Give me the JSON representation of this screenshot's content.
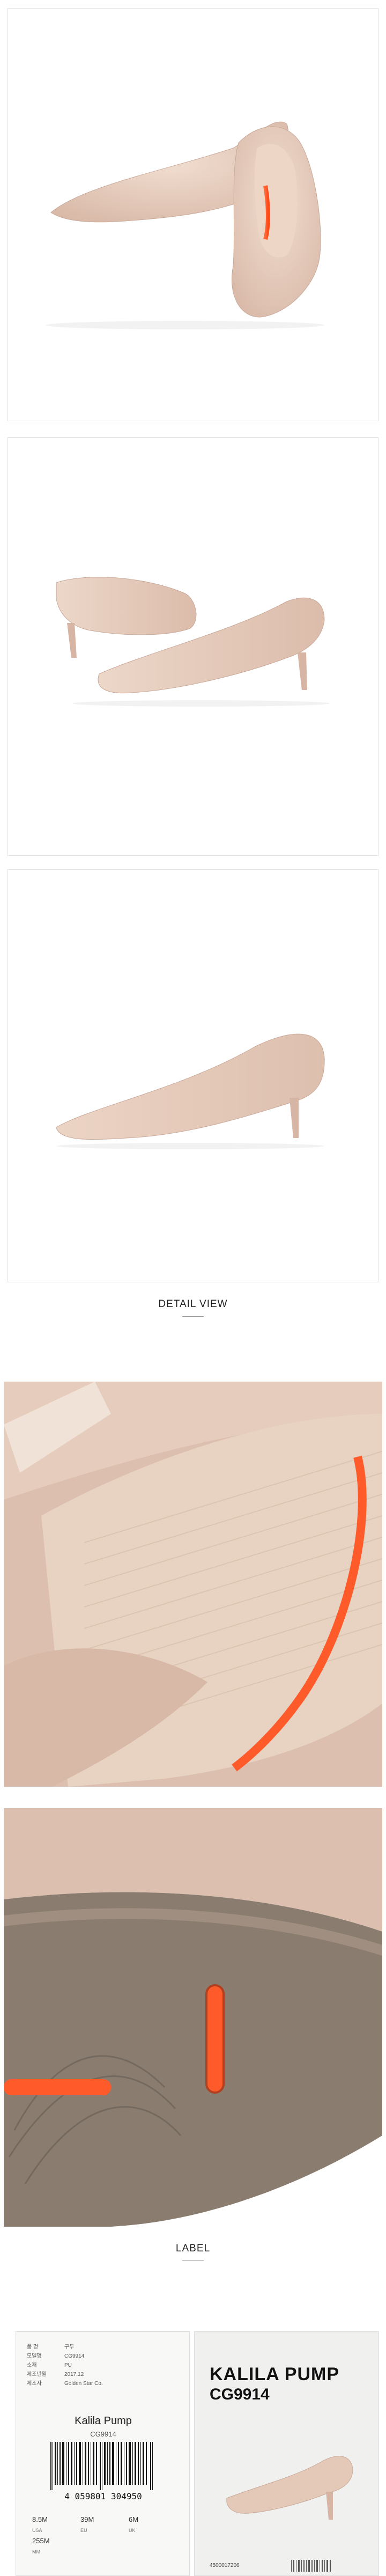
{
  "sections": {
    "detail_title": "DETAIL VIEW",
    "label_title": "LABEL"
  },
  "label_card": {
    "rows": [
      {
        "key": "품 명",
        "value": "구두"
      },
      {
        "key": "모델명",
        "value": "CG9914"
      },
      {
        "key": "소재",
        "value": "PU"
      },
      {
        "key": "제조년월",
        "value": "2017.12"
      },
      {
        "key": "제조자",
        "value": "Golden Star Co."
      }
    ],
    "product_name": "Kalila Pump",
    "product_code": "CG9914",
    "barcode_number": "4 059801 304950",
    "sizes": {
      "row1": [
        "8.5M",
        "39M",
        "6M"
      ],
      "row1_labels": [
        "USA",
        "EU",
        "UK"
      ],
      "row2": [
        "255M"
      ],
      "row2_labels": [
        "MM"
      ]
    }
  },
  "box_label": {
    "name": "KALILA PUMP",
    "code": "CG9914",
    "upc": "4500017206"
  },
  "colors": {
    "suede": "#e8cfc0",
    "suede_dark": "#d4b3a2",
    "lining": "#e9d2c0",
    "accent_orange": "#ff5a2a",
    "outsole": "#8a7d70"
  }
}
